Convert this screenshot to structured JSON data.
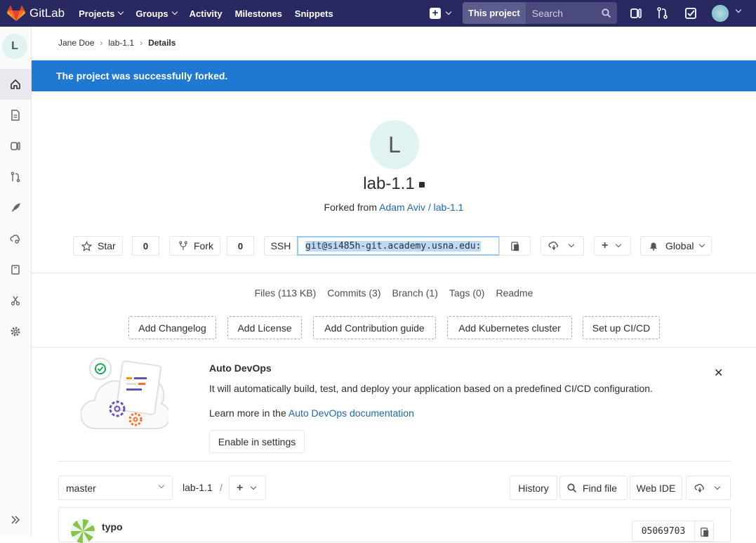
{
  "navbar": {
    "brand": "GitLab",
    "links": [
      "Projects",
      "Groups",
      "Activity",
      "Milestones",
      "Snippets"
    ],
    "search_scope": "This project",
    "search_placeholder": "Search"
  },
  "sidebar": {
    "project_initial": "L"
  },
  "breadcrumb": {
    "items": [
      "Jane Doe",
      "lab-1.1",
      "Details"
    ]
  },
  "flash": {
    "message": "The project was successfully forked."
  },
  "project": {
    "initial": "L",
    "name": "lab-1.1",
    "forked_prefix": "Forked from",
    "forked_link": "Adam Aviv / lab-1.1"
  },
  "actions": {
    "star_label": "Star",
    "star_count": "0",
    "fork_label": "Fork",
    "fork_count": "0",
    "ssh_label": "SSH",
    "ssh_url": "git@si485h-git.academy.usna.edu:",
    "notification_label": "Global"
  },
  "stats": [
    "Files (113 KB)",
    "Commits (3)",
    "Branch (1)",
    "Tags (0)",
    "Readme"
  ],
  "quick_buttons": [
    "Add Changelog",
    "Add License",
    "Add Contribution guide",
    "Add Kubernetes cluster",
    "Set up CI/CD"
  ],
  "auto_devops": {
    "title": "Auto DevOps",
    "text": "It will automatically build, test, and deploy your application based on a predefined CI/CD configuration.",
    "learn_prefix": "Learn more in the",
    "learn_link": "Auto DevOps documentation",
    "button": "Enable in settings"
  },
  "tree": {
    "branch": "master",
    "path": "lab-1.1",
    "sep": "/",
    "history": "History",
    "find_file": "Find file",
    "web_ide": "Web IDE"
  },
  "commit": {
    "title": "typo",
    "sha": "05069703"
  },
  "colors": {
    "navbar": "#292961",
    "flash": "#1f78d1",
    "link": "#1b69b6"
  }
}
